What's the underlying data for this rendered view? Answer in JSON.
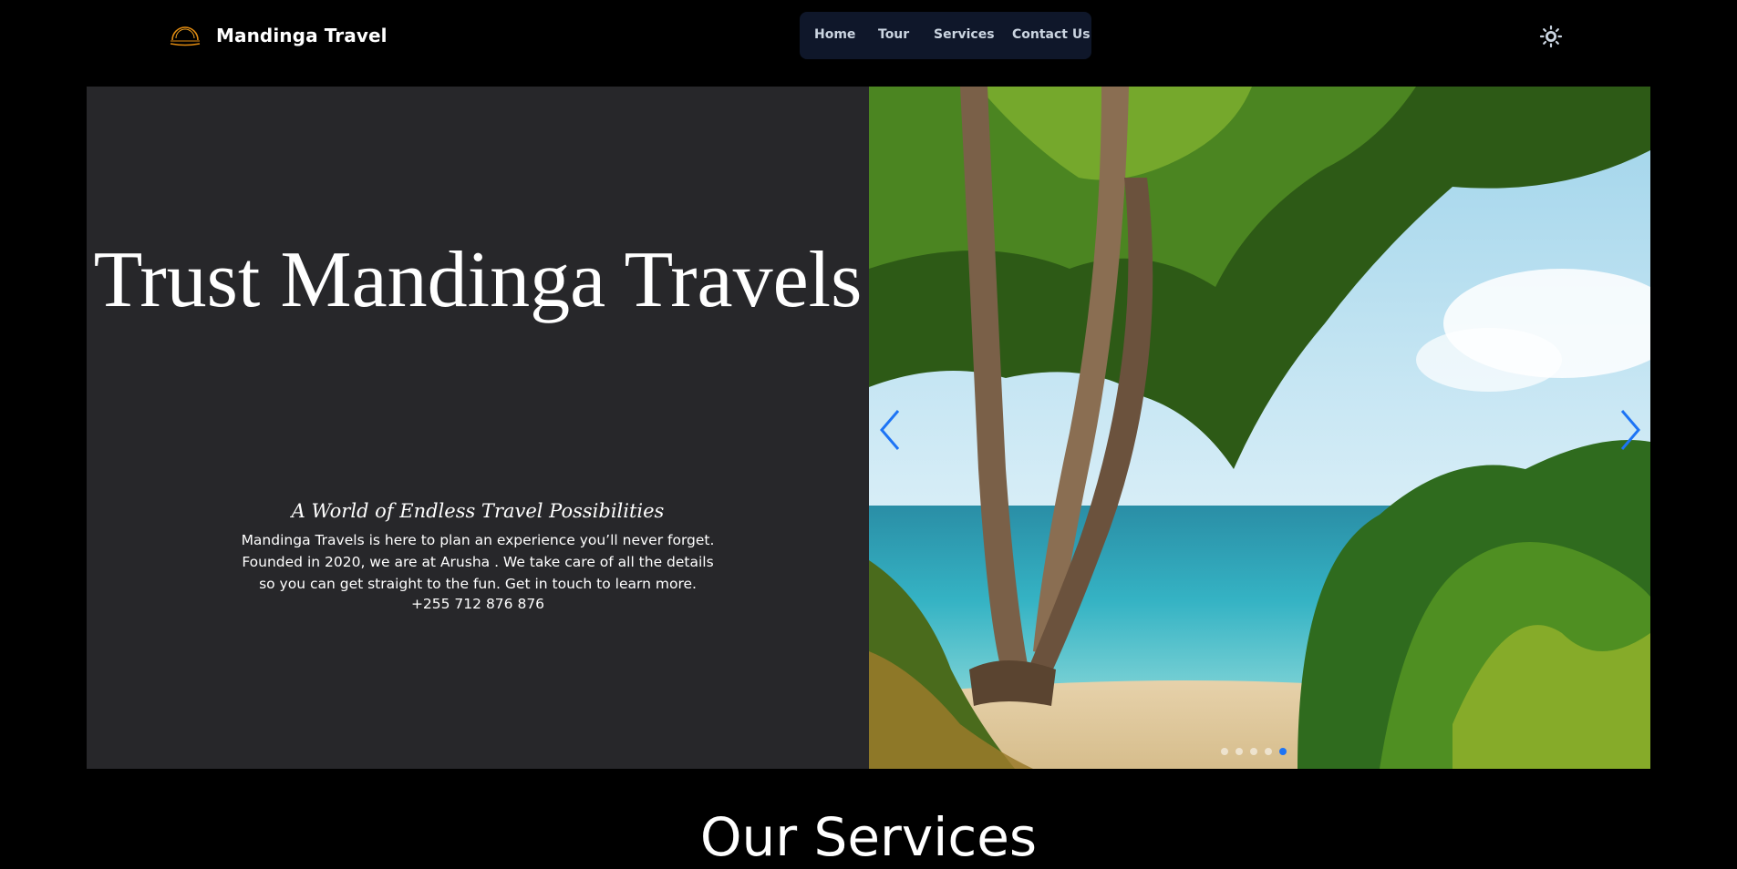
{
  "header": {
    "brand_name": "Mandinga Travel",
    "logo_icon": "sunset-logo-icon",
    "nav": [
      {
        "label": "Home"
      },
      {
        "label": "Tour"
      },
      {
        "label": "Services"
      },
      {
        "label": "Contact Us"
      }
    ],
    "theme_icon": "sun-icon"
  },
  "hero": {
    "title": "Trust Mandinga Travels",
    "tagline": "A World of Endless Travel Possibilities",
    "description": "Mandinga Travels is here to plan an experience you’ll never forget. Founded in 2020, we are at Arusha . We take care of all the details so you can get straight to the fun. Get in touch to learn more.",
    "phone": "+255 712 876 876",
    "carousel": {
      "prev_icon": "chevron-left-icon",
      "next_icon": "chevron-right-icon",
      "slide_count": 5,
      "active_slide": 5
    }
  },
  "services": {
    "title": "Our Services"
  },
  "colors": {
    "background": "#000000",
    "nav_bg": "#0f172a",
    "hero_left_bg": "#27272a",
    "accent": "#1d74f5"
  }
}
